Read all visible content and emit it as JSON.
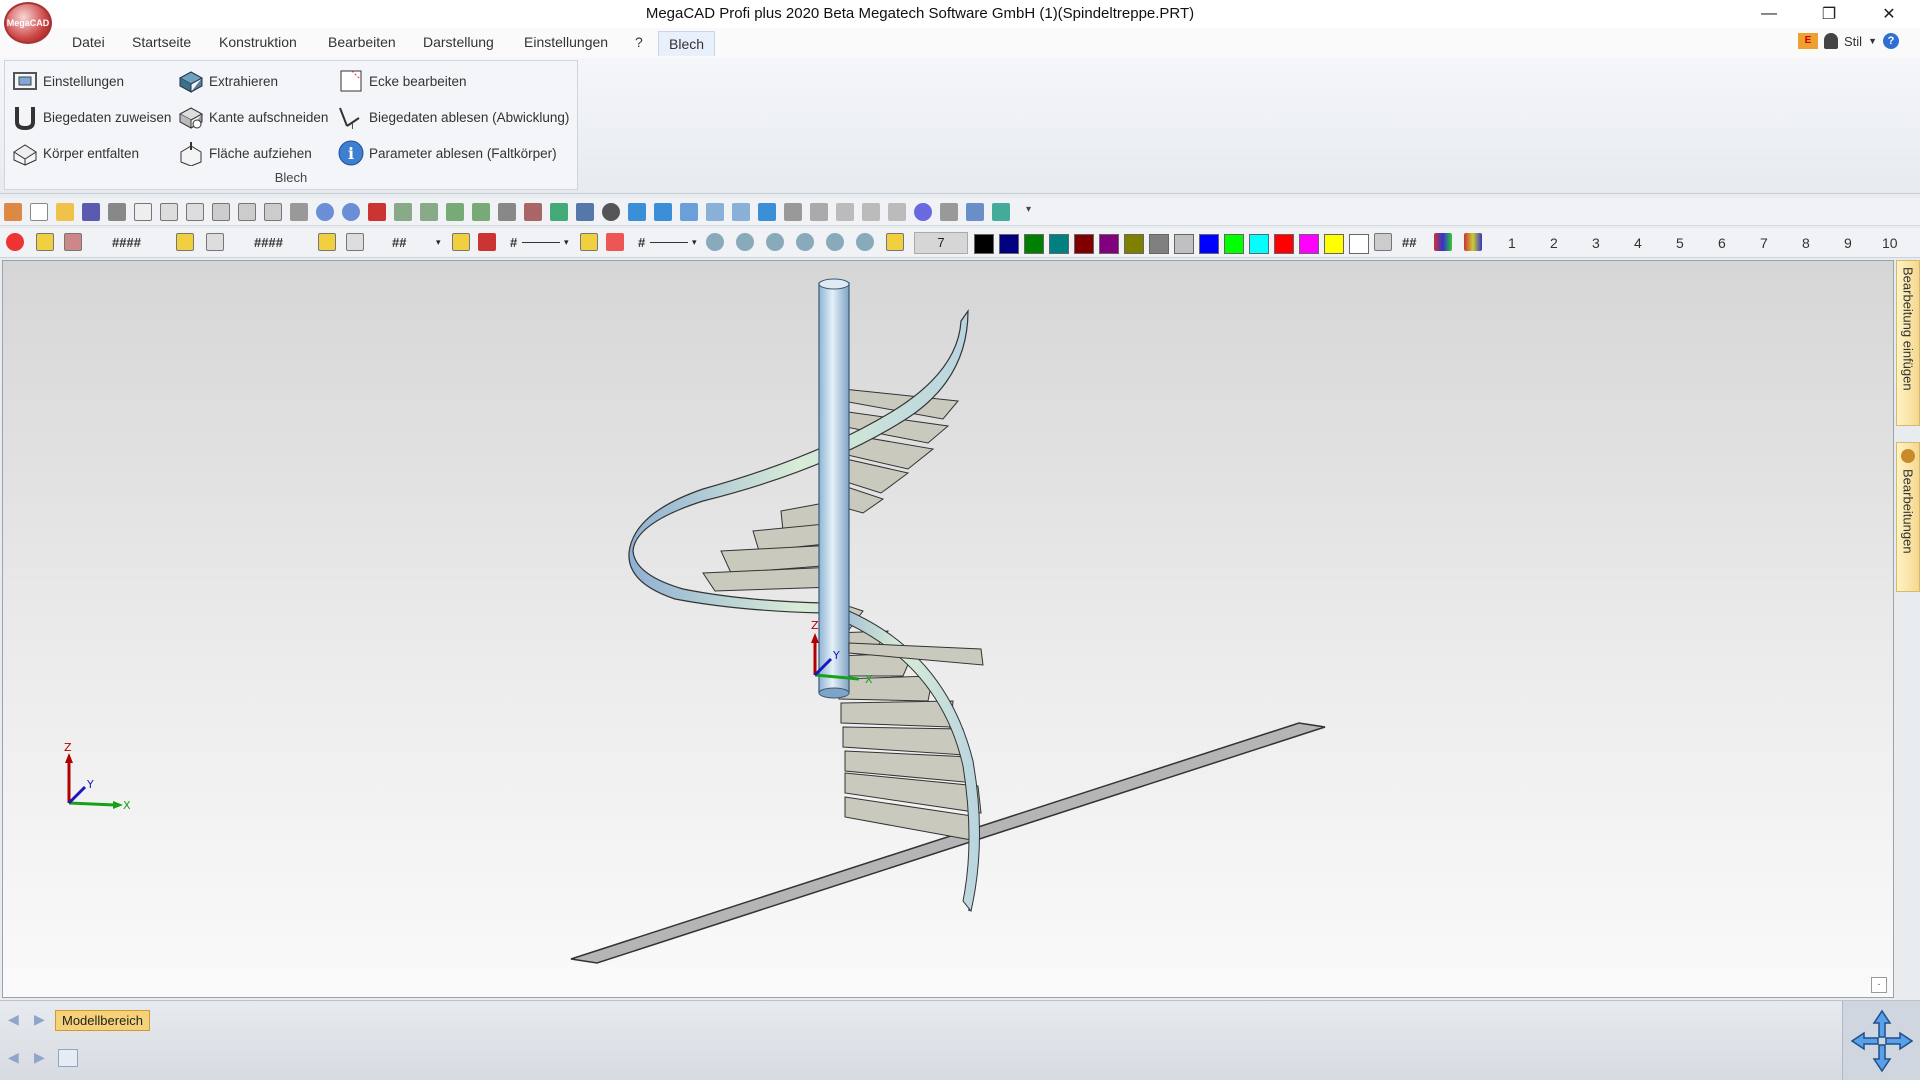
{
  "window": {
    "title": "MegaCAD Profi plus 2020  Beta  Megatech Software GmbH (1)(Spindeltreppe.PRT)",
    "logo_text": "MegaCAD",
    "minimize": "—",
    "maximize": "❐",
    "close": "✕"
  },
  "menu": {
    "items": [
      "Datei",
      "Startseite",
      "Konstruktion",
      "Bearbeiten",
      "Darstellung",
      "Einstellungen",
      "?",
      "Blech"
    ],
    "right": {
      "stil": "Stil",
      "help": "?"
    }
  },
  "ribbon": {
    "group_label": "Blech",
    "col1": [
      "Einstellungen",
      "Biegedaten zuweisen",
      "Körper entfalten"
    ],
    "col2": [
      "Extrahieren",
      "Kante aufschneiden",
      "Fläche aufziehen"
    ],
    "col3": [
      "Ecke bearbeiten",
      "Biegedaten ablesen (Abwicklung)",
      "Parameter  ablesen (Faltkörper)"
    ]
  },
  "toolbar2": {
    "hash1": "####",
    "hash2": "####",
    "hash3": "##",
    "hash4": "#",
    "hash5": "#",
    "color_index": "7",
    "hash6": "##",
    "layers": [
      "1",
      "2",
      "3",
      "4",
      "5",
      "6",
      "7",
      "8",
      "9",
      "10"
    ]
  },
  "colors": {
    "swatches": [
      "#000000",
      "#000080",
      "#008000",
      "#008080",
      "#800000",
      "#800080",
      "#808000",
      "#808080",
      "#c0c0c0",
      "#0000ff",
      "#00ff00",
      "#00ffff",
      "#ff0000",
      "#ff00ff",
      "#ffff00",
      "#ffffff"
    ]
  },
  "canvas": {
    "axis_z": "Z",
    "axis_y": "Y",
    "axis_x": "X"
  },
  "side_tabs": {
    "top": "Bearbeitung einfügen",
    "bottom": "Bearbeitungen"
  },
  "bottom": {
    "model_tab": "Modellbereich"
  }
}
